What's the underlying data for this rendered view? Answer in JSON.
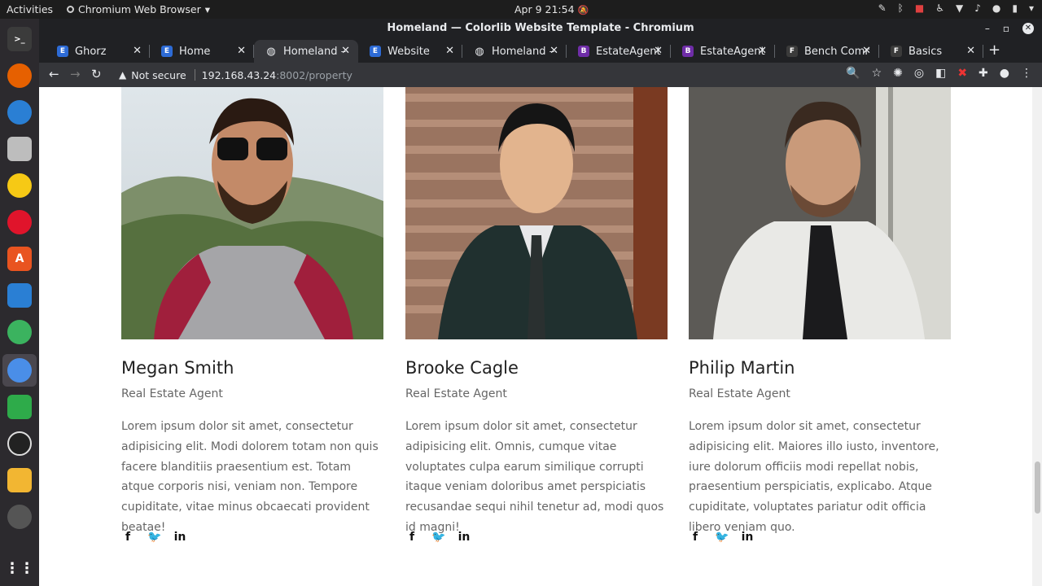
{
  "topbar": {
    "activities": "Activities",
    "app_menu": "Chromium Web Browser",
    "clock": "Apr 9  21:54"
  },
  "window": {
    "title": "Homeland — Colorlib Website Template - Chromium"
  },
  "tabs": [
    {
      "label": "Ghorz",
      "favicon": "E",
      "color": "#2d6bd6"
    },
    {
      "label": "Home",
      "favicon": "E",
      "color": "#2d6bd6"
    },
    {
      "label": "Homeland –",
      "favicon": "globe",
      "color": "#e8eaed",
      "active": true
    },
    {
      "label": "Website",
      "favicon": "E",
      "color": "#2d6bd6"
    },
    {
      "label": "Homeland –",
      "favicon": "globe",
      "color": "#e8eaed"
    },
    {
      "label": "EstateAgent",
      "favicon": "B",
      "color": "#6f2da8"
    },
    {
      "label": "EstateAgent",
      "favicon": "B",
      "color": "#6f2da8"
    },
    {
      "label": "Bench Comm",
      "favicon": "F",
      "color": "#3b3b3b"
    },
    {
      "label": "Basics",
      "favicon": "F",
      "color": "#3b3b3b"
    }
  ],
  "omnibox": {
    "security": "Not secure",
    "host": "192.168.43.24",
    "path": ":8002/property"
  },
  "agents": [
    {
      "name": "Megan Smith",
      "role": "Real Estate Agent",
      "bio": "Lorem ipsum dolor sit amet, consectetur adipisicing elit. Modi dolorem totam non quis facere blanditiis praesentium est. Totam atque corporis nisi, veniam non. Tempore cupiditate, vitae minus obcaecati provident beatae!"
    },
    {
      "name": "Brooke Cagle",
      "role": "Real Estate Agent",
      "bio": "Lorem ipsum dolor sit amet, consectetur adipisicing elit. Omnis, cumque vitae voluptates culpa earum similique corrupti itaque veniam doloribus amet perspiciatis recusandae sequi nihil tenetur ad, modi quos id magni!"
    },
    {
      "name": "Philip Martin",
      "role": "Real Estate Agent",
      "bio": "Lorem ipsum dolor sit amet, consectetur adipisicing elit. Maiores illo iusto, inventore, iure dolorum officiis modi repellat nobis, praesentium perspiciatis, explicabo. Atque cupiditate, voluptates pariatur odit officia libero veniam quo."
    }
  ],
  "social_icons": [
    "facebook-icon",
    "twitter-icon",
    "linkedin-icon"
  ]
}
